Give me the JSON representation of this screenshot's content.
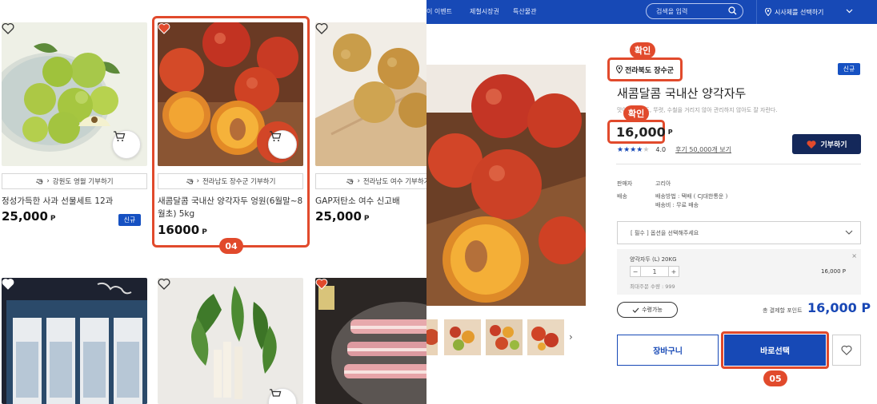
{
  "colors": {
    "accent": "#1749b6",
    "highlight": "#e14a2c",
    "dark_navy": "#14285a"
  },
  "grid": {
    "products": [
      {
        "donate_label": "강원도 영월 기부하기",
        "name": "정성가득한 사과 선물세트 12과",
        "price": "25,000",
        "currency": "P",
        "badge": "",
        "wished": false,
        "image": "green-apples"
      },
      {
        "donate_label": "전라남도 장수군 기부하기",
        "name": "새콤달콤 국내산 양각자두 엉원(6월말~8월초) 5kg",
        "price": "16000",
        "currency": "P",
        "badge": "",
        "wished": true,
        "image": "plums"
      },
      {
        "donate_label": "전라남도 여수 기부하기",
        "name": "GAP저탄소 여수 신고배",
        "price": "25,000",
        "currency": "P",
        "badge": "신규",
        "wished": false,
        "image": "pears"
      },
      {
        "name": "",
        "wished": true,
        "image": "gift-box-radish"
      },
      {
        "name": "",
        "wished": false,
        "image": "young-radish"
      },
      {
        "name": "",
        "wished": true,
        "image": "pork-belly"
      }
    ],
    "step_badge": "04"
  },
  "nav": {
    "items": [
      "이 이벤트",
      "제철시장권",
      "특산물관"
    ],
    "search_placeholder": "검색을 입력",
    "region": "시사체를 선택하기",
    "icons": {
      "search": "search-icon",
      "location": "map-pin-icon",
      "dropdown": "chevron-down-icon"
    }
  },
  "detail": {
    "confirm_label_1": "확인",
    "confirm_label_2": "확인",
    "location": "전라북도 장수군",
    "new_tag": "신규",
    "title": "새콤달콤 국내산 양각자두",
    "subtitle": "맛이 지었어도, 뚜렷, 수철을 거리지 않아 관리하지 않아도 잘 자란다.",
    "price": "16,000",
    "currency": "P",
    "rating": "4.0",
    "rating_value": 4,
    "review_link": "후기 50,000개 보기",
    "donate_button": "기부하기",
    "seller_label": "판매자",
    "seller_value": "고리아",
    "shipping_label": "배송",
    "shipping_method": "배송방법 : 택배 ( CJ대한통운 )",
    "shipping_fee": "배송비 : 무료 배송",
    "option_placeholder": "[ 필수 ] 옵션을 선택해주세요",
    "selected_item_name": "양각자두 (L) 20KG",
    "selected_quantity": "1",
    "selected_item_price": "16,000 P",
    "max_purchase": "최대주문 수량 : 999",
    "pickup_label": "수령가능",
    "total_label": "총 결제할 포인트",
    "total_price": "16,000 P",
    "cart_button": "장바구니",
    "buy_button": "바로선택",
    "step_badge": "05"
  }
}
